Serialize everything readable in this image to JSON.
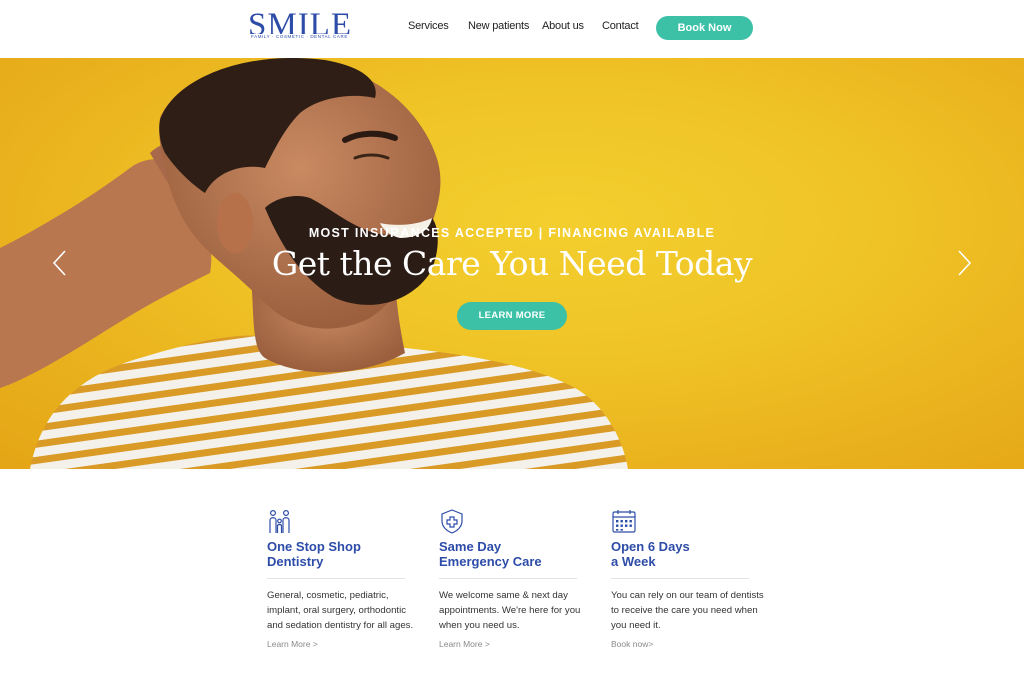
{
  "header": {
    "logo_text": "SMILE",
    "logo_tagline": "FAMILY · COSMETIC · DENTAL CARE",
    "nav": [
      "Services",
      "New patients",
      "About us",
      "Contact"
    ],
    "cta_label": "Book Now"
  },
  "hero": {
    "kicker": "MOST INSURANCES ACCEPTED | FINANCING AVAILABLE",
    "title": "Get the Care You Need Today",
    "button_label": "LEARN MORE"
  },
  "features": [
    {
      "icon": "family-icon",
      "title": "One Stop Shop\nDentistry",
      "body": "General, cosmetic, pediatric,\nimplant, oral surgery, orthodontic\nand sedation dentistry for all ages.",
      "link": "Learn More >"
    },
    {
      "icon": "shield-plus-icon",
      "title": "Same Day\nEmergency Care",
      "body": "We welcome same & next day\nappointments. We're here for you\nwhen you need us.",
      "link": "Learn More >"
    },
    {
      "icon": "calendar-icon",
      "title": "Open 6 Days\na Week",
      "body": "You can rely on our team of dentists\nto receive the care you need when\nyou need it.",
      "link": "Book now>"
    }
  ],
  "colors": {
    "brand_blue": "#2d4ca8",
    "accent_teal": "#3cc1a7",
    "hero_yellow": "#efc326"
  }
}
